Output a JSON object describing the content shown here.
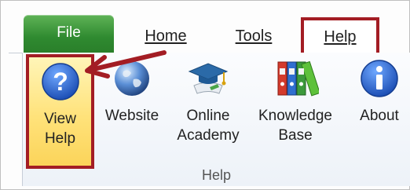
{
  "tabs": {
    "file": "File",
    "home": "Home",
    "tools": "Tools",
    "help": "Help"
  },
  "ribbon": {
    "buttons": {
      "view_help": [
        "View",
        "Help"
      ],
      "website": [
        "Website"
      ],
      "online_academy": [
        "Online",
        "Academy"
      ],
      "knowledge_base": [
        "Knowledge",
        "Base"
      ],
      "about": [
        "About"
      ]
    },
    "group_label": "Help"
  },
  "colors": {
    "highlight_border": "#a31d24",
    "file_tab": "#3a963a",
    "selected_button": "#ffe27a"
  },
  "icons": {
    "view_help": "question-mark-icon",
    "website": "globe-icon",
    "online_academy": "graduation-cap-icon",
    "knowledge_base": "binders-icon",
    "about": "info-icon"
  }
}
